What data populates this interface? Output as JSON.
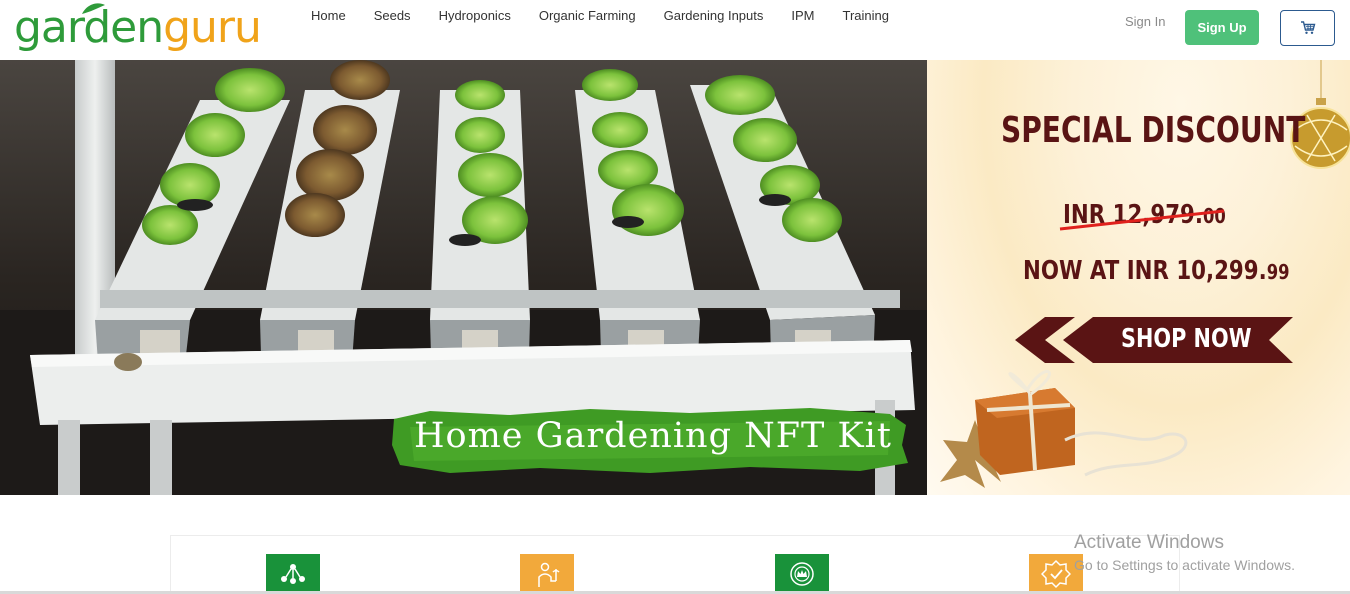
{
  "brand": {
    "part1": "garden",
    "part2": "guru"
  },
  "nav": [
    {
      "label": "Home"
    },
    {
      "label": "Seeds"
    },
    {
      "label": "Hydroponics"
    },
    {
      "label": "Organic Farming"
    },
    {
      "label": "Gardening Inputs"
    },
    {
      "label": "IPM"
    },
    {
      "label": "Training"
    }
  ],
  "auth": {
    "signin_label": "Sign In",
    "signup_label": "Sign Up"
  },
  "icons": {
    "cart": "cart-icon"
  },
  "colors": {
    "brand_green": "#2e9b3a",
    "brand_orange": "#f0a31a",
    "signup_green": "#4fc17a",
    "ad_maroon": "#5a1414",
    "strike_red": "#e0211d"
  },
  "hero": {
    "caption": "Home Gardening NFT Kit",
    "ad": {
      "title": "SPECIAL DISCOUNT",
      "old_price_main": "INR 12,979.",
      "old_price_cents": "00",
      "new_price_main": "NOW AT INR 10,299.",
      "new_price_cents": "99",
      "cta": "SHOP NOW"
    }
  },
  "features": [
    {
      "icon": "network-icon",
      "color": "green"
    },
    {
      "icon": "farmer-icon",
      "color": "orange"
    },
    {
      "icon": "quality-badge-icon",
      "color": "green"
    },
    {
      "icon": "certified-badge-icon",
      "color": "orange"
    }
  ],
  "watermark": {
    "line1": "Activate Windows",
    "line2": "Go to Settings to activate Windows."
  }
}
